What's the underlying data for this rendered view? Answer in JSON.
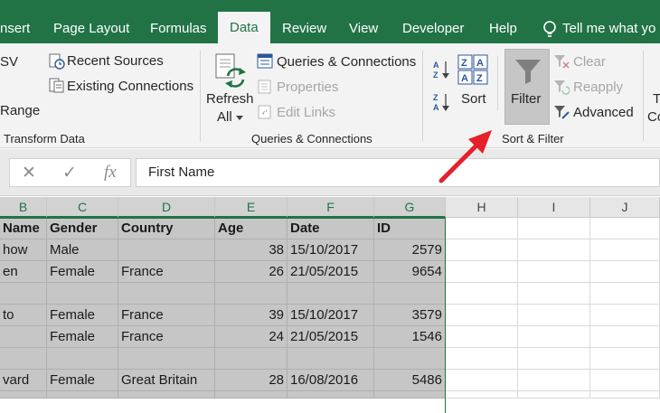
{
  "ribbon_tabs": {
    "insert": "nsert",
    "page_layout": "Page Layout",
    "formulas": "Formulas",
    "data": "Data",
    "review": "Review",
    "view": "View",
    "developer": "Developer",
    "help": "Help",
    "tell_me": "Tell me what yo"
  },
  "get_transform": {
    "from_csv": "SV",
    "range": "Range",
    "recent_sources": "Recent Sources",
    "existing_connections": "Existing Connections",
    "group_label": "Transform Data"
  },
  "queries": {
    "refresh_all_line1": "Refresh",
    "refresh_all_line2": "All",
    "queries_connections": "Queries & Connections",
    "properties": "Properties",
    "edit_links": "Edit Links",
    "group_label": "Queries & Connections"
  },
  "sort_filter": {
    "sort": "Sort",
    "filter": "Filter",
    "clear": "Clear",
    "reapply": "Reapply",
    "advanced": "Advanced",
    "group_label": "Sort & Filter"
  },
  "data_tools": {
    "text_to_cols_line1": "T",
    "text_to_cols_line2": "Co"
  },
  "formula_bar": {
    "cancel_symbol": "✕",
    "enter_symbol": "✓",
    "fx_symbol": "fx",
    "content": "First Name"
  },
  "columns": [
    "B",
    "C",
    "D",
    "E",
    "F",
    "G",
    "H",
    "I",
    "J"
  ],
  "table": {
    "headers": [
      "Name",
      "Gender",
      "Country",
      "Age",
      "Date",
      "ID"
    ],
    "rows": [
      [
        "how",
        "Male",
        "",
        "38",
        "15/10/2017",
        "2579"
      ],
      [
        "en",
        "Female",
        "France",
        "26",
        "21/05/2015",
        "9654"
      ],
      [
        "",
        "",
        "",
        "",
        "",
        ""
      ],
      [
        "to",
        "Female",
        "France",
        "39",
        "15/10/2017",
        "3579"
      ],
      [
        "",
        "Female",
        "France",
        "24",
        "21/05/2015",
        "1546"
      ],
      [
        "",
        "",
        "",
        "",
        "",
        ""
      ],
      [
        "vard",
        "Female",
        "Great Britain",
        "28",
        "16/08/2016",
        "5486"
      ]
    ]
  },
  "colors": {
    "excel_green": "#217346",
    "selection_gray": "#c6c6c6",
    "arrow_red": "#e5202a"
  }
}
